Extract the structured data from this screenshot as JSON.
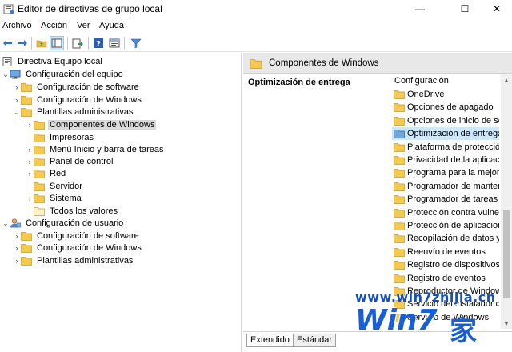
{
  "window": {
    "title": "Editor de directivas de grupo local",
    "minimize": "—",
    "maximize": "☐",
    "close": "✕"
  },
  "menu": [
    "Archivo",
    "Acción",
    "Ver",
    "Ayuda"
  ],
  "toolbar": {
    "icons": [
      "back-arrow-icon",
      "forward-arrow-icon",
      "up-folder-icon",
      "show-hide-tree-icon",
      "export-list-icon",
      "help-icon",
      "properties-icon",
      "filter-icon"
    ]
  },
  "tree": {
    "root": "Directiva Equipo local",
    "computer_config": "Configuración del equipo",
    "cc_software": "Configuración de software",
    "cc_windows": "Configuración de Windows",
    "cc_admin": "Plantillas administrativas",
    "admin_children": [
      "Componentes de Windows",
      "Impresoras",
      "Menú Inicio y barra de tareas",
      "Panel de control",
      "Red",
      "Servidor",
      "Sistema",
      "Todos los valores"
    ],
    "user_config": "Configuración de usuario",
    "uc_software": "Configuración de software",
    "uc_windows": "Configuración de Windows",
    "uc_admin": "Plantillas administrativas"
  },
  "right_pane": {
    "header": "Componentes de Windows",
    "description_title": "Optimización de entrega",
    "column_header": "Configuración",
    "items": [
      "OneDrive",
      "Opciones de apagado",
      "Opciones de inicio de sesi",
      "Optimización de entrega",
      "Plataforma de protección",
      "Privacidad de la aplicación",
      "Programa para la mejora d",
      "Programador de mantenir",
      "Programador de tareas",
      "Protección contra vulnera",
      "Protección de aplicacione",
      "Recopilación de datos y ve",
      "Reenvío de eventos",
      "Registro de dispositivos",
      "Registro de eventos",
      "Reproductor de Windows",
      "Servicio del instalador de A",
      "Servicio de Windows"
    ],
    "selected_index": 3,
    "tabs": [
      "Extendido",
      "Estándar"
    ]
  },
  "watermark": {
    "url": "www.win7zhijia.cn",
    "logo": "Win7",
    "home": "家"
  }
}
